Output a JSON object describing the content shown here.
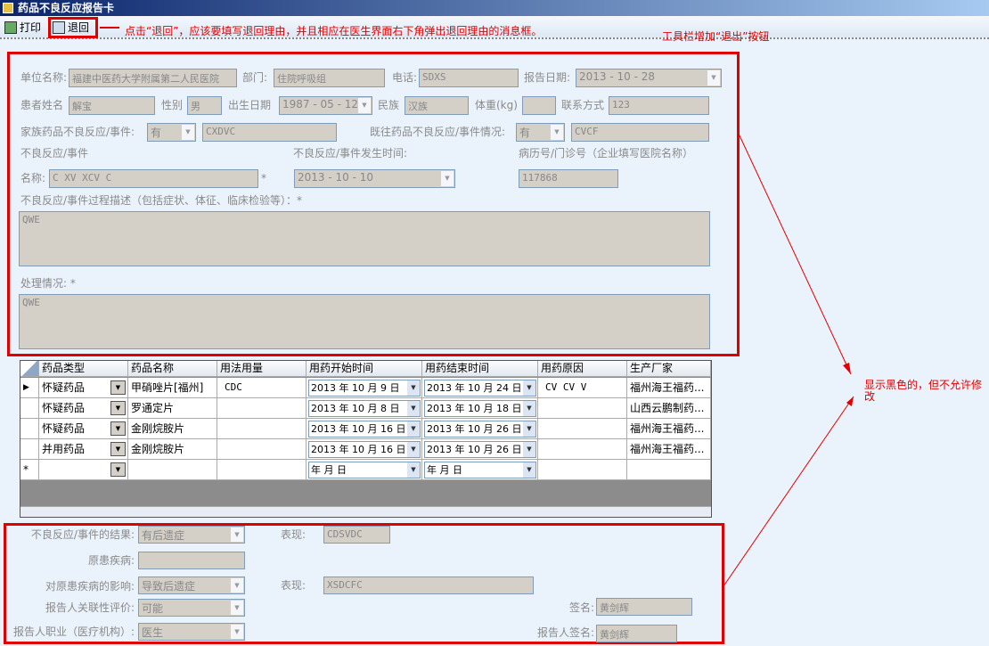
{
  "window": {
    "title": "药品不良反应报告卡"
  },
  "toolbar": {
    "print": "打印",
    "return": "退回"
  },
  "annotations": {
    "return_note": "点击“退回”，应该要填写退回理由，并且相应在医生界面右下角弹出退回理由的消息框。",
    "toolbar_note": "工具栏增加“退出”按钮",
    "readonly_note": "显示黑色的，但不允许修改",
    "color": "#e00000"
  },
  "form": {
    "unit_label": "单位名称:",
    "unit": "福建中医药大学附属第二人民医院",
    "dept_label": "部门:",
    "dept": "住院呼吸组",
    "phone_label": "电话:",
    "phone": "SDXS",
    "report_date_label": "报告日期:",
    "report_date": "2013 - 10 - 28",
    "patient_label": "患者姓名",
    "patient": "解宝",
    "sex_label": "性别",
    "sex": "男",
    "birth_label": "出生日期",
    "birth": "1987 - 05 - 12",
    "nation_label": "民族",
    "nation": "汉族",
    "weight_label": "体重(kg)",
    "weight": "",
    "contact_label": "联系方式",
    "contact": "123",
    "family_label": "家族药品不良反应/事件:",
    "family": "有",
    "family_detail": "CXDVC",
    "history_label": "既往药品不良反应/事件情况:",
    "history": "有",
    "history_detail": "CVCF",
    "event_label": "不良反应/事件",
    "event_time_label": "不良反应/事件发生时间:",
    "record_label": "病历号/门诊号（企业填写医院名称）",
    "name_label": "名称:",
    "name": "C XV XCV C",
    "star": "*",
    "event_time": "2013 - 10 - 10",
    "record": "117868",
    "desc_label": "不良反应/事件过程描述（包括症状、体征、临床检验等）：*",
    "desc": "QWE",
    "handle_label": "处理情况: *",
    "handle": "QWE"
  },
  "grid": {
    "headers": [
      "药品类型",
      "药品名称",
      "用法用量",
      "用药开始时间",
      "用药结束时间",
      "用药原因",
      "生产厂家"
    ],
    "rows": [
      [
        "怀疑药品",
        "甲硝唑片[福州]",
        "CDC",
        "2013 年 10 月 9 日",
        "2013 年 10 月 24 日",
        "CV CV V",
        "福州海王福药..."
      ],
      [
        "怀疑药品",
        "罗通定片",
        "",
        "2013 年 10 月 8 日",
        "2013 年 10 月 18 日",
        "",
        "山西云鹏制药..."
      ],
      [
        "怀疑药品",
        "金刚烷胺片",
        "",
        "2013 年 10 月 16 日",
        "2013 年 10 月 26 日",
        "",
        "福州海王福药..."
      ],
      [
        "并用药品",
        "金刚烷胺片",
        "",
        "2013 年 10 月 16 日",
        "2013 年 10 月 26 日",
        "",
        "福州海王福药..."
      ]
    ],
    "new_row": {
      "marker": "*",
      "start": "  年   月   日",
      "end": "  年   月   日"
    },
    "current_marker": "▶"
  },
  "bottom": {
    "result_label": "不良反应/事件的结果:",
    "result": "有后遗症",
    "perf1_label": "表现:",
    "perf1": "CDSVDC",
    "disease_label": "原患疾病:",
    "disease": "",
    "effect_label": "对原患疾病的影响:",
    "effect": "导致后遗症",
    "perf2_label": "表现:",
    "perf2": "XSDCFC",
    "eval_label": "报告人关联性评价:",
    "eval": "可能",
    "sign_label": "签名:",
    "sign": "黄剑辉",
    "job_label": "报告人职业（医疗机构）:",
    "job": "医生",
    "reporter_sign_label": "报告人签名:",
    "reporter_sign": "黄剑辉"
  }
}
